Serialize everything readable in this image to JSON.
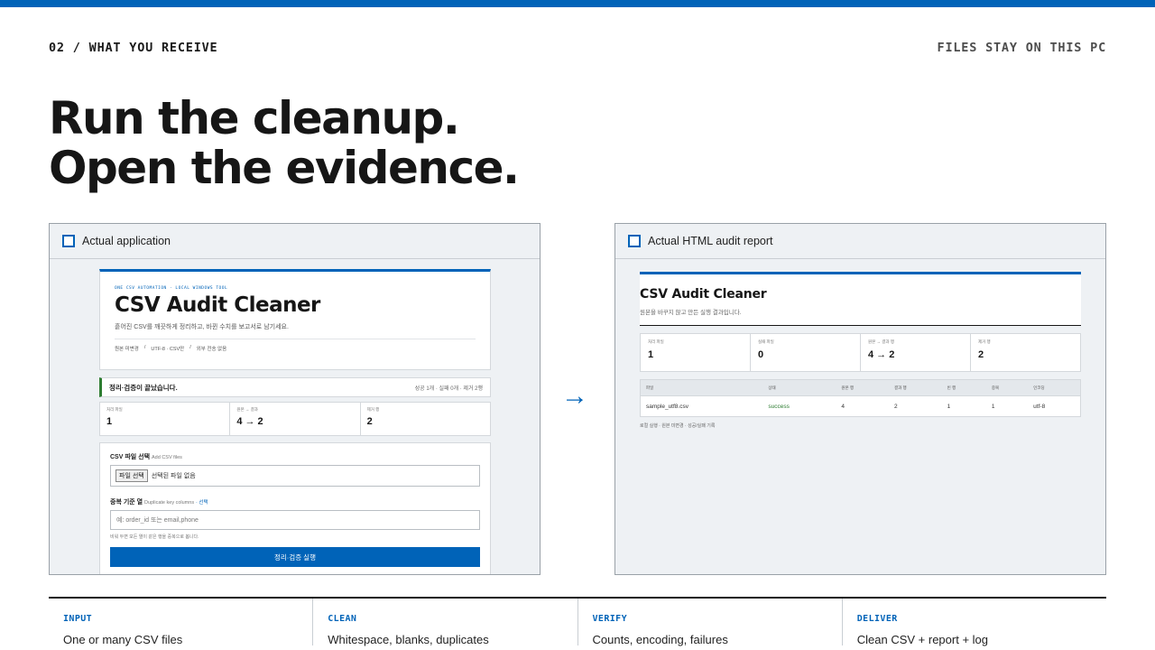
{
  "header": {
    "eyebrow_left": "02 / WHAT YOU RECEIVE",
    "eyebrow_right": "FILES STAY ON THIS PC"
  },
  "headline": {
    "line1": "Run the cleanup.",
    "line2": "Open the evidence."
  },
  "colors": {
    "accent": "#0063b8",
    "success": "#2e7d32",
    "text": "#161616"
  },
  "left_panel": {
    "title": "Actual application",
    "app": {
      "kicker": "ONE CSV AUTOMATION · LOCAL WINDOWS TOOL",
      "title": "CSV Audit Cleaner",
      "description": "흩어진 CSV를 깨끗하게 정리하고, 바뀐 수치를 보고서로 남기세요.",
      "meta": [
        "원본 미변경",
        "/",
        "UTF-8 · CSV만",
        "/",
        "외부 전송 없음"
      ],
      "status_text": "정리·검증이 끝났습니다.",
      "status_counts": "성공 1개 · 실패 0개 · 제거 2행",
      "metrics": [
        {
          "label": "처리 파일",
          "value": "1"
        },
        {
          "label": "원본 → 결과",
          "value": "4 → 2"
        },
        {
          "label": "제거 행",
          "value": "2"
        }
      ],
      "file_label": "CSV 파일 선택",
      "file_sub": "Add CSV files",
      "file_button": "파일 선택",
      "file_text": "선택된 파일 없음",
      "dup_label": "중복 기준 열",
      "dup_sub": "Duplicate key columns",
      "dup_optional": "· 선택",
      "dup_placeholder": "예: order_id 또는 email,phone",
      "dup_help": "비워 두면 모든 열이 같은 행을 중복으로 봅니다.",
      "run_button": "정리·검증 실행"
    }
  },
  "right_panel": {
    "title": "Actual HTML audit report",
    "report": {
      "title": "CSV Audit Cleaner",
      "subtitle": "원본을 바꾸지 않고 만든 실행 결과입니다.",
      "metrics": [
        {
          "label": "처리 파일",
          "value": "1"
        },
        {
          "label": "실패 파일",
          "value": "0"
        },
        {
          "label": "원본 → 결과 행",
          "value": "4 → 2"
        },
        {
          "label": "제거 행",
          "value": "2"
        }
      ],
      "table_headers": [
        "파일",
        "상태",
        "원본 행",
        "결과 행",
        "빈 행",
        "중복",
        "인코딩"
      ],
      "table_rows": [
        [
          "sample_utf8.csv",
          "success",
          "4",
          "2",
          "1",
          "1",
          "utf-8"
        ]
      ],
      "footer": "로컬 실행 · 원본 미변경 · 성공/실패 기록"
    }
  },
  "arrow": "→",
  "steps": [
    {
      "label": "INPUT",
      "text": "One or many CSV files"
    },
    {
      "label": "CLEAN",
      "text": "Whitespace, blanks, duplicates"
    },
    {
      "label": "VERIFY",
      "text": "Counts, encoding, failures"
    },
    {
      "label": "DELIVER",
      "text": "Clean CSV + report + log"
    }
  ]
}
